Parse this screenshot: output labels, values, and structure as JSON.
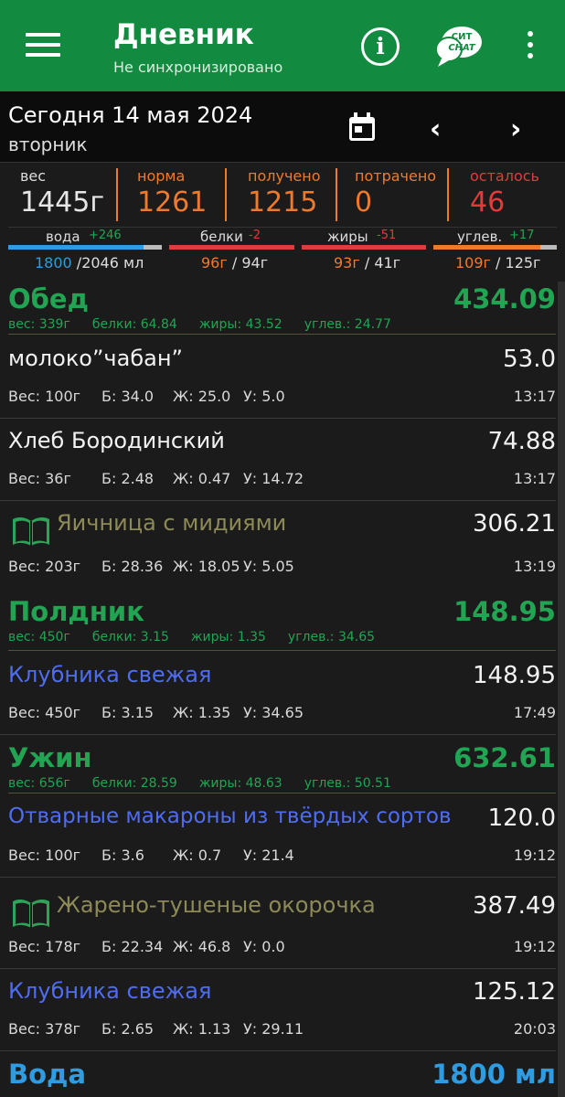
{
  "appbar": {
    "title": "Дневник",
    "subtitle": "Не синхронизировано",
    "icons": [
      "menu-icon",
      "info-icon",
      "chat-icon",
      "more-vert-icon"
    ],
    "chat_badge_top": "СИТ",
    "chat_badge_bottom": "CHAT"
  },
  "date": {
    "line": "Сегодня 14 мая 2024",
    "weekday": "вторник",
    "prev": "‹",
    "next": "›"
  },
  "stats": {
    "weight": {
      "label": "вес",
      "value": "1445г"
    },
    "norm": {
      "label": "норма",
      "value": "1261"
    },
    "received": {
      "label": "получено",
      "value": "1215"
    },
    "spent": {
      "label": "потрачено",
      "value": "0"
    },
    "left": {
      "label": "осталось",
      "value": "46"
    }
  },
  "macros": {
    "water": {
      "label": "вода",
      "delta": "+246",
      "current": "1800",
      "total": " /2046 мл",
      "fill": 0.88
    },
    "protein": {
      "label": "белки",
      "delta": "-2",
      "current": "96г",
      "total": " / 94г",
      "fill": 1.0
    },
    "fat": {
      "label": "жиры",
      "delta": "-51",
      "current": "93г",
      "total": " / 41г",
      "fill": 1.0
    },
    "carbs": {
      "label": "углев.",
      "delta": "+17",
      "current": "109г",
      "total": " / 125г",
      "fill": 0.87
    }
  },
  "colors": {
    "green": "#21a552",
    "orange": "#f07a2c",
    "red": "#e23b3b",
    "blue": "#4f6cf2",
    "olive": "#8c8a57",
    "water": "#2f9be0"
  },
  "meals": [
    {
      "name": "Обед",
      "kcal": "434.09",
      "sum": {
        "weight": "вес: 339г",
        "protein": "белки: 64.84",
        "fat": "жиры: 43.52",
        "carbs": "углев.: 24.77"
      },
      "items": [
        {
          "name": "молоко”чабан”",
          "kcal": "53.0",
          "weight": "Вес: 100г",
          "protein": "Б: 34.0",
          "fat": "Ж: 25.0",
          "carbs": "У: 5.0",
          "time": "13:17"
        },
        {
          "name": "Хлеб Бородинский",
          "kcal": "74.88",
          "weight": "Вес: 36г",
          "protein": "Б: 2.48",
          "fat": "Ж: 0.47",
          "carbs": "У: 14.72",
          "time": "13:17"
        },
        {
          "name": "Яичница с мидиями",
          "kcal": "306.21",
          "weight": "Вес: 203г",
          "protein": "Б: 28.36",
          "fat": "Ж: 18.05",
          "carbs": "У: 5.05",
          "time": "13:19"
        }
      ]
    },
    {
      "name": "Полдник",
      "kcal": "148.95",
      "sum": {
        "weight": "вес: 450г",
        "protein": "белки: 3.15",
        "fat": "жиры: 1.35",
        "carbs": "углев.: 34.65"
      },
      "items": [
        {
          "name": "Клубника свежая",
          "kcal": "148.95",
          "weight": "Вес: 450г",
          "protein": "Б: 3.15",
          "fat": "Ж: 1.35",
          "carbs": "У: 34.65",
          "time": "17:49"
        }
      ]
    },
    {
      "name": "Ужин",
      "kcal": "632.61",
      "sum": {
        "weight": "вес: 656г",
        "protein": "белки: 28.59",
        "fat": "жиры: 48.63",
        "carbs": "углев.: 50.51"
      },
      "items": [
        {
          "name": "Отварные макароны из твёрдых сортов",
          "kcal": "120.0",
          "weight": "Вес: 100г",
          "protein": "Б: 3.6",
          "fat": "Ж: 0.7",
          "carbs": "У: 21.4",
          "time": "19:12"
        },
        {
          "name": "Жарено-тушеные окорочка",
          "kcal": "387.49",
          "weight": "Вес: 178г",
          "protein": "Б: 22.34",
          "fat": "Ж: 46.8",
          "carbs": "У: 0.0",
          "time": "19:12"
        },
        {
          "name": "Клубника свежая",
          "kcal": "125.12",
          "weight": "Вес: 378г",
          "protein": "Б: 2.65",
          "fat": "Ж: 1.13",
          "carbs": "У: 29.11",
          "time": "20:03"
        }
      ]
    }
  ],
  "water": {
    "name": "Вода",
    "value": "1800 мл"
  }
}
